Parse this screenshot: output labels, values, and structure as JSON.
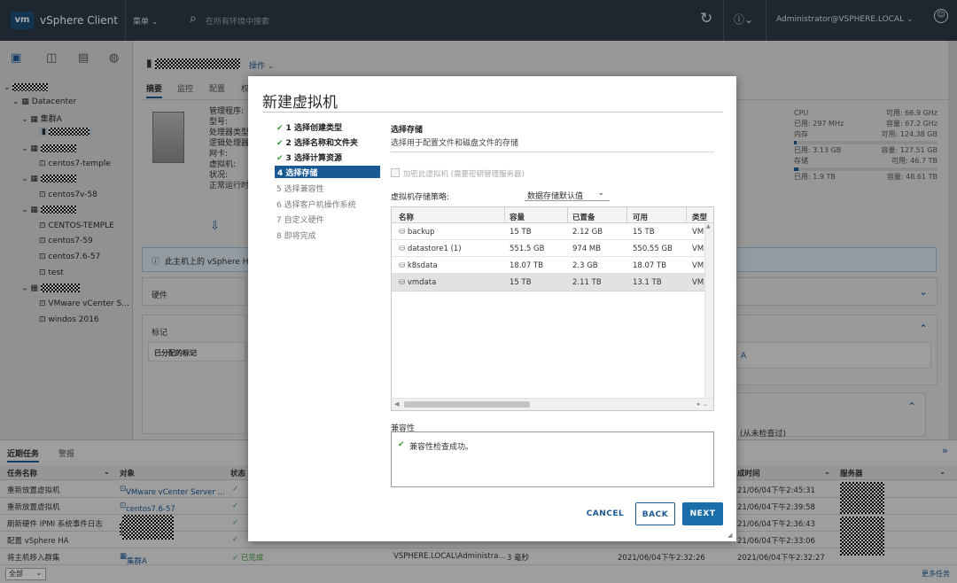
{
  "header": {
    "logo": "vm",
    "app": "vSphere Client",
    "menu": "菜单",
    "search_placeholder": "在所有环境中搜索",
    "user": "Administrator@VSPHERE.LOCAL"
  },
  "left_tabs": [
    "hosts-clusters-icon",
    "vms-templates-icon",
    "storage-icon",
    "networking-icon"
  ],
  "tree": {
    "datacenter": "Datacenter",
    "cluster": "集群A",
    "host_vm1": "centos7-temple",
    "host_vm2": "centos7v-58",
    "vm_temple": "CENTOS-TEMPLE",
    "vm1": "centos7-59",
    "vm2": "centos7.6-57",
    "vm3": "test",
    "vm4": "VMware vCenter S...",
    "vm5": "windos 2016"
  },
  "object_tabs": {
    "summary": "摘要",
    "monitor": "监控",
    "configure": "配置",
    "more": "权",
    "actions": "操作"
  },
  "host_props": [
    "管理程序:",
    "型号:",
    "处理器类型:",
    "逻辑处理器:",
    "网卡:",
    "虚拟机:",
    "状况:",
    "正常运行时间:"
  ],
  "resources": {
    "cpu": "CPU",
    "cpu_free": "可用: 66.9 GHz",
    "cpu_used": "已用: 297 MHz",
    "cpu_cap": "容量: 67.2 GHz",
    "mem": "内存",
    "mem_free": "可用: 124.38 GB",
    "mem_used": "已用: 3.13 GB",
    "mem_cap": "容量: 127.51 GB",
    "storage": "存储",
    "st_free": "可用: 46.7 TB",
    "st_used": "已用: 1.9 TB",
    "st_cap": "容量: 48.61 TB"
  },
  "ha_notice": "此主机上的 vSphere HA",
  "panels": {
    "hardware": "硬件",
    "tags": "标记",
    "assigned_tags": "已分配的标记",
    "ha_link": "A",
    "last_check": "(从未检查过)"
  },
  "modal": {
    "title": "新建虚拟机",
    "steps": [
      {
        "label": "1 选择创建类型",
        "state": "done"
      },
      {
        "label": "2 选择名称和文件夹",
        "state": "done"
      },
      {
        "label": "3 选择计算资源",
        "state": "done"
      },
      {
        "label": "4 选择存储",
        "state": "active"
      },
      {
        "label": "5 选择兼容性",
        "state": "pending"
      },
      {
        "label": "6 选择客户机操作系统",
        "state": "pending"
      },
      {
        "label": "7 自定义硬件",
        "state": "pending"
      },
      {
        "label": "8 即将完成",
        "state": "pending"
      }
    ],
    "section_title": "选择存储",
    "section_desc": "选择用于配置文件和磁盘文件的存储",
    "encrypt_label": "加密此虚拟机 (需要密钥管理服务器)",
    "policy_label": "虚拟机存储策略:",
    "policy_value": "数据存储默认值",
    "columns": [
      "名称",
      "容量",
      "已置备",
      "可用",
      "类型"
    ],
    "rows": [
      [
        "backup",
        "15 TB",
        "2.12 GB",
        "15 TB",
        "VM"
      ],
      [
        "datastore1 (1)",
        "551.5 GB",
        "974 MB",
        "550.55 GB",
        "VM"
      ],
      [
        "k8sdata",
        "18.07 TB",
        "2.3 GB",
        "18.07 TB",
        "VM"
      ],
      [
        "vmdata",
        "15 TB",
        "2.11 TB",
        "13.1 TB",
        "VM"
      ]
    ],
    "compat_label": "兼容性",
    "compat_msg": "兼容性检查成功。",
    "cancel": "CANCEL",
    "back": "BACK",
    "next": "NEXT"
  },
  "tasks": {
    "tab_recent": "近期任务",
    "tab_alarms": "警报",
    "col_task": "任务名称",
    "col_target": "对象",
    "col_status": "状态",
    "col_done": "成时间",
    "col_server": "服务器",
    "rows": [
      {
        "task": "重新放置虚拟机",
        "target": "VMware vCenter Server ...",
        "status": "✓",
        "time": "21/06/04下午2:45:31"
      },
      {
        "task": "重新放置虚拟机",
        "target": "centos7.6-57",
        "status": "✓",
        "time": "21/06/04下午2:39:58"
      },
      {
        "task": "刷新硬件 IPMI 系统事件日志",
        "target": "",
        "status": "✓",
        "time": "21/06/04下午2:36:43"
      },
      {
        "task": "配置 vSphere HA",
        "target": "",
        "status": "✓",
        "time": "21/06/04下午2:33:06"
      },
      {
        "task": "将主机移入群集",
        "target": "集群A",
        "status": "✓ 已完成",
        "initiator": "VSPHERE.LOCAL\\Administra...",
        "queued": "3 毫秒",
        "start": "2021/06/04下午2:32:26",
        "time": "2021/06/04下午2:32:27"
      }
    ],
    "filter": "全部",
    "more": "更多任务"
  }
}
